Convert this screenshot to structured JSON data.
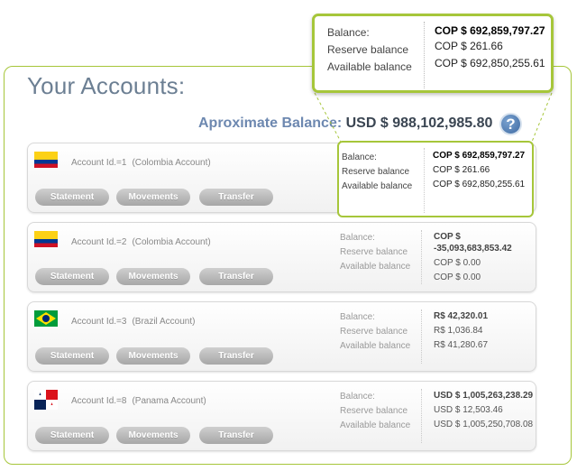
{
  "page_title": "Your Accounts:",
  "approximate_balance": {
    "label": "Aproximate Balance:",
    "value": "USD $ 988,102,985.80"
  },
  "help_icon": "?",
  "labels": {
    "balance": "Balance:",
    "reserve": "Reserve balance",
    "available": "Available balance"
  },
  "buttons": {
    "statement": "Statement",
    "movements": "Movements",
    "transfer": "Transfer"
  },
  "accounts": [
    {
      "id_label": "Account Id.=1",
      "name": "(Colombia Account)",
      "flag": "colombia",
      "balance": "COP $ 692,859,797.27",
      "reserve": "COP $ 261.66",
      "available": "COP $ 692,850,255.61"
    },
    {
      "id_label": "Account Id.=2",
      "name": "(Colombia Account)",
      "flag": "colombia",
      "balance": "COP $ -35,093,683,853.42",
      "reserve": "COP $ 0.00",
      "available": "COP $ 0.00"
    },
    {
      "id_label": "Account Id.=3",
      "name": "(Brazil Account)",
      "flag": "brazil",
      "balance": "R$ 42,320.01",
      "reserve": "R$ 1,036.84",
      "available": "R$ 41,280.67"
    },
    {
      "id_label": "Account Id.=8",
      "name": "(Panama Account)",
      "flag": "panama",
      "balance": "USD $ 1,005,263,238.29",
      "reserve": "USD $ 12,503.46",
      "available": "USD $ 1,005,250,708.08"
    }
  ],
  "popup": {
    "balance": "COP $ 692,859,797.27",
    "reserve": "COP $ 261.66",
    "available": "COP $ 692,850,255.61"
  },
  "colors": {
    "accent_green": "#a6c63a",
    "title_gray_blue": "#6c7f93",
    "approx_label_blue": "#6d88b0",
    "button_gray": "#b8b8b8"
  }
}
